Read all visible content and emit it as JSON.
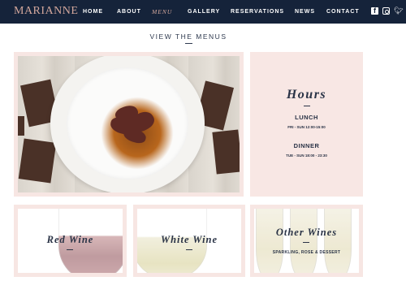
{
  "brand": {
    "logo": "MARIANNE",
    "logo_color": "#d4a89d"
  },
  "nav": {
    "background": "#15233a",
    "items": [
      "HOME",
      "ABOUT",
      "MENU",
      "GALLERY",
      "RESERVATIONS",
      "NEWS",
      "CONTACT"
    ],
    "active": "MENU",
    "social": [
      "facebook-icon",
      "instagram-icon",
      "twitter-icon"
    ]
  },
  "section": {
    "title": "VIEW THE MENUS"
  },
  "hours": {
    "title": "Hours",
    "lunch_label": "LUNCH",
    "lunch_time": "FRI - SUN 12:00-15:00",
    "dinner_label": "DINNER",
    "dinner_time": "TUE - SUN 18:00 - 23:30"
  },
  "wines": {
    "red": {
      "title": "Red Wine"
    },
    "white": {
      "title": "White Wine"
    },
    "other": {
      "title": "Other Wines",
      "subtitle": "SPARKLING, ROSE & DESSERT"
    }
  },
  "colors": {
    "card_pink": "#f7e6e3",
    "text_navy": "#2a3346"
  }
}
